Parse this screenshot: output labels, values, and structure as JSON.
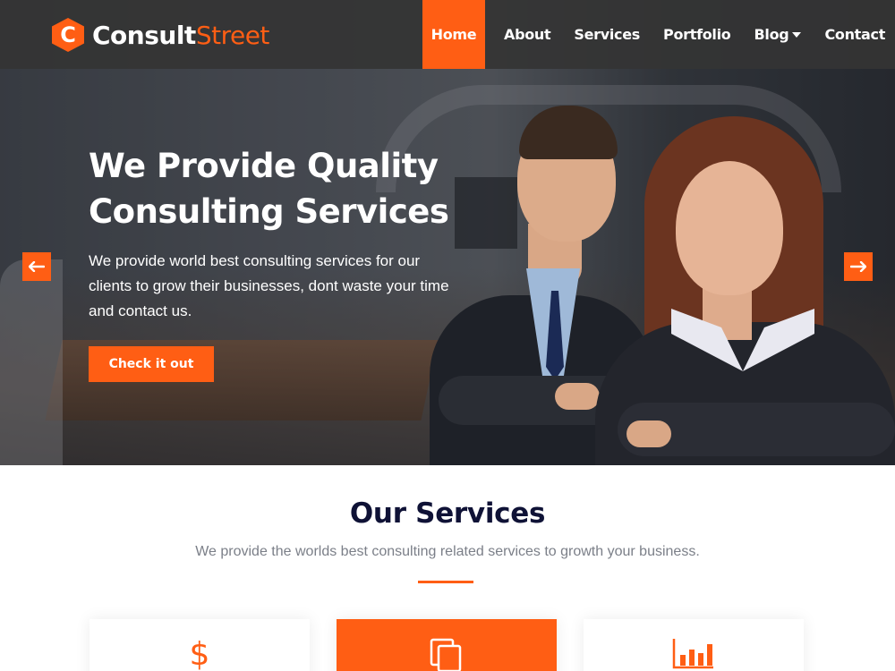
{
  "brand": {
    "name_part1": "Consult",
    "name_part2": "Street",
    "mark_letter": "C"
  },
  "nav": {
    "items": [
      {
        "label": "Home",
        "active": true
      },
      {
        "label": "About"
      },
      {
        "label": "Services"
      },
      {
        "label": "Portfolio"
      },
      {
        "label": "Blog",
        "has_dropdown": true
      },
      {
        "label": "Contact"
      }
    ]
  },
  "hero": {
    "title_line1": "We Provide Quality",
    "title_line2": "Consulting Services",
    "text": "We provide world best consulting services for our clients to grow their businesses, dont waste your time and contact us.",
    "button_label": "Check it out",
    "prev_icon": "arrow-left-icon",
    "next_icon": "arrow-right-icon"
  },
  "services": {
    "title": "Our Services",
    "subtitle": "We provide the worlds best consulting related services to growth your business.",
    "cards": [
      {
        "icon": "dollar-icon",
        "glyph": "$"
      },
      {
        "icon": "copy-icon",
        "highlighted": true
      },
      {
        "icon": "bar-chart-icon"
      }
    ]
  },
  "colors": {
    "accent": "#ff5e14",
    "nav_bg": "#343434",
    "heading": "#0f1236",
    "muted_text": "#7b7f88"
  }
}
